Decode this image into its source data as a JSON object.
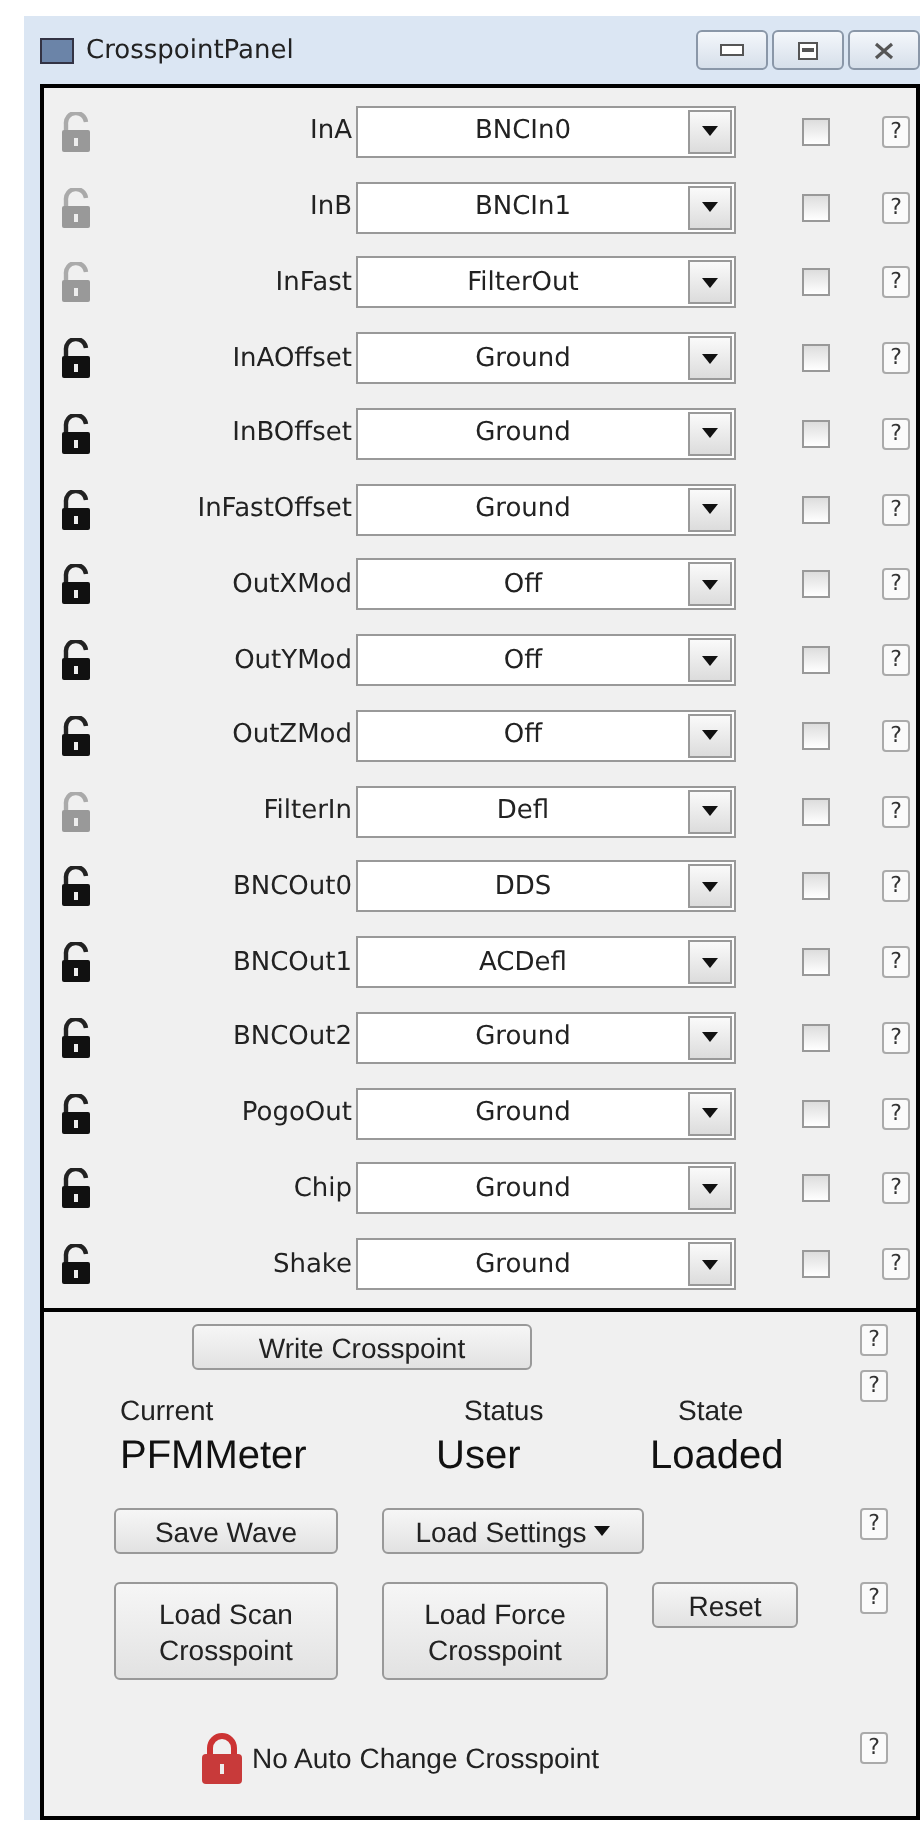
{
  "window": {
    "title": "CrosspointPanel"
  },
  "rows": [
    {
      "label": "InA",
      "value": "BNCIn0",
      "enabled": false,
      "checked": false,
      "help": "?"
    },
    {
      "label": "InB",
      "value": "BNCIn1",
      "enabled": false,
      "checked": false,
      "help": "?"
    },
    {
      "label": "InFast",
      "value": "FilterOut",
      "enabled": false,
      "checked": false,
      "help": "?"
    },
    {
      "label": "InAOffset",
      "value": "Ground",
      "enabled": true,
      "checked": false,
      "help": "?"
    },
    {
      "label": "InBOffset",
      "value": "Ground",
      "enabled": true,
      "checked": false,
      "help": "?"
    },
    {
      "label": "InFastOffset",
      "value": "Ground",
      "enabled": true,
      "checked": false,
      "help": "?"
    },
    {
      "label": "OutXMod",
      "value": "Off",
      "enabled": true,
      "checked": false,
      "help": "?"
    },
    {
      "label": "OutYMod",
      "value": "Off",
      "enabled": true,
      "checked": false,
      "help": "?"
    },
    {
      "label": "OutZMod",
      "value": "Off",
      "enabled": true,
      "checked": false,
      "help": "?"
    },
    {
      "label": "FilterIn",
      "value": "Defl",
      "enabled": false,
      "checked": false,
      "help": "?"
    },
    {
      "label": "BNCOut0",
      "value": "DDS",
      "enabled": true,
      "checked": false,
      "help": "?"
    },
    {
      "label": "BNCOut1",
      "value": "ACDefl",
      "enabled": true,
      "checked": false,
      "help": "?"
    },
    {
      "label": "BNCOut2",
      "value": "Ground",
      "enabled": true,
      "checked": false,
      "help": "?"
    },
    {
      "label": "PogoOut",
      "value": "Ground",
      "enabled": true,
      "checked": false,
      "help": "?"
    },
    {
      "label": "Chip",
      "value": "Ground",
      "enabled": true,
      "checked": false,
      "help": "?"
    },
    {
      "label": "Shake",
      "value": "Ground",
      "enabled": true,
      "checked": false,
      "help": "?"
    }
  ],
  "controls": {
    "write_button": "Write Crosspoint",
    "write_help": "?",
    "headers": [
      "Current",
      "Status",
      "State"
    ],
    "headers_help": "?",
    "values": [
      "PFMMeter",
      "User",
      "Loaded"
    ],
    "save_wave": "Save Wave",
    "load_settings": "Load Settings",
    "load_help": "?",
    "load_scan": "Load Scan Crosspoint",
    "load_force": "Load Force Crosspoint",
    "reset": "Reset",
    "reset_help": "?",
    "auto_change": "No Auto Change Crosspoint",
    "auto_help": "?"
  }
}
